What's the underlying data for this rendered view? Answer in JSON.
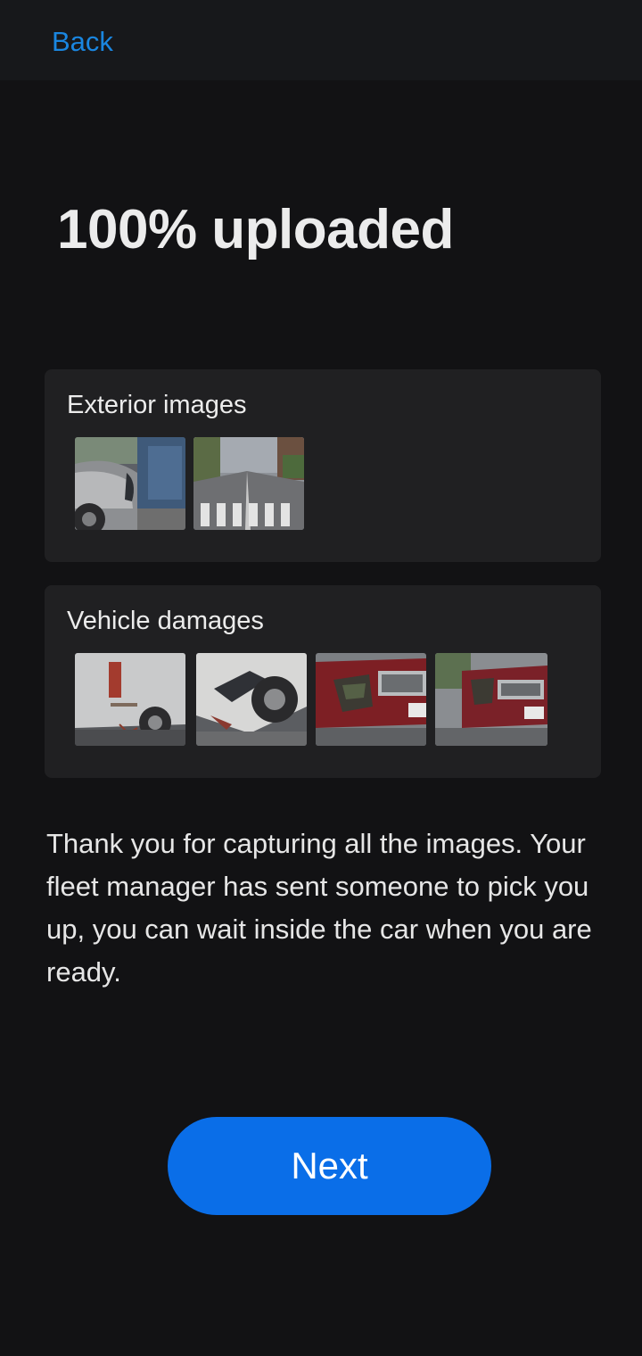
{
  "header": {
    "back_label": "Back"
  },
  "title": "100% uploaded",
  "sections": {
    "exterior": {
      "title": "Exterior images",
      "images": [
        "car-rear-damage-photo",
        "street-crossing-photo"
      ]
    },
    "damages": {
      "title": "Vehicle damages",
      "images": [
        "white-van-side-damage-photo",
        "white-car-bumper-damage-photo",
        "red-car-front-damage-photo",
        "red-car-front-angle-photo"
      ]
    }
  },
  "message": "Thank you for capturing all the images. Your fleet manager has sent someone to pick you up, you can wait inside the car when you are ready.",
  "buttons": {
    "next_label": "Next"
  },
  "colors": {
    "accent": "#0a6ee8",
    "link": "#1a86e0",
    "background": "#121214",
    "card": "#202022"
  }
}
